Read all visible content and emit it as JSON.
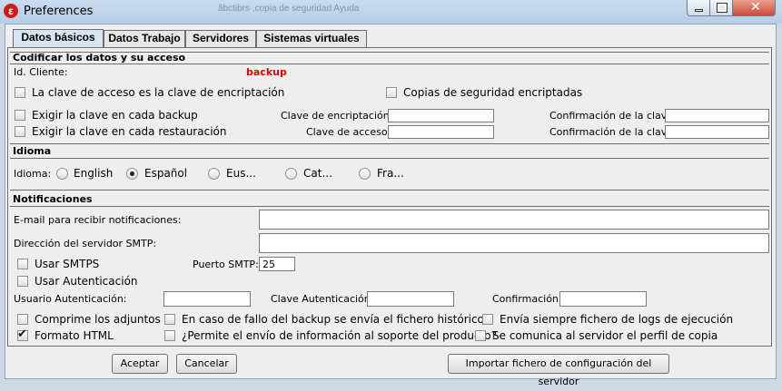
{
  "window": {
    "title": "Preferences",
    "ghost_text": "ăbctibrs ,copia de seguridad Ayuda"
  },
  "tabs": [
    "Datos básicos",
    "Datos Trabajo",
    "Servidores",
    "Sistemas virtuales"
  ],
  "encrypt": {
    "section_title": "Codificar los datos y su acceso",
    "client_id_label": "Id. Cliente:",
    "client_id_value": "backup",
    "cb_key_is_encryption": "La clave de acceso es la clave de encriptación",
    "cb_encrypted_backups": "Copias de seguridad encriptadas",
    "cb_require_key_backup": "Exigir la clave en cada backup",
    "cb_require_key_restore": "Exigir la clave en cada restauración",
    "encryption_key_label": "Clave de encriptación:",
    "access_key_label": "Clave de acceso",
    "confirm_label_1": "Confirmación de la clave:",
    "confirm_label_2": "Confirmación de la clave:"
  },
  "language": {
    "section_title": "Idioma",
    "label": "Idioma:",
    "options": [
      "English",
      "Español",
      "Eus...",
      "Cat...",
      "Fra..."
    ],
    "selected": "Español"
  },
  "notifications": {
    "section_title": "Notificaciones",
    "email_label": "E-mail para recibir notificaciones:",
    "smtp_server_label": "Dirección del servidor SMTP:",
    "cb_smtps": "Usar SMTPS",
    "smtp_port_label": "Puerto SMTP:",
    "smtp_port_value": "25",
    "cb_auth": "Usar Autenticación",
    "auth_user_label": "Usuario Autenticación:",
    "auth_key_label": "Clave Autenticación:",
    "confirm_label": "Confirmación:",
    "cb_compress": "Comprime los adjuntos",
    "cb_send_history": "En caso de fallo del backup se envía el fichero histórico",
    "cb_send_logs": "Envía siempre fichero de logs de ejecución",
    "cb_html": "Formato HTML",
    "cb_send_info": "¿Permite el envío de información al soporte del producto?",
    "cb_profile": "Se comunica al servidor el perfil de copia"
  },
  "buttons": {
    "accept": "Aceptar",
    "cancel": "Cancelar",
    "import": "Importar fichero de configuración del servidor"
  }
}
